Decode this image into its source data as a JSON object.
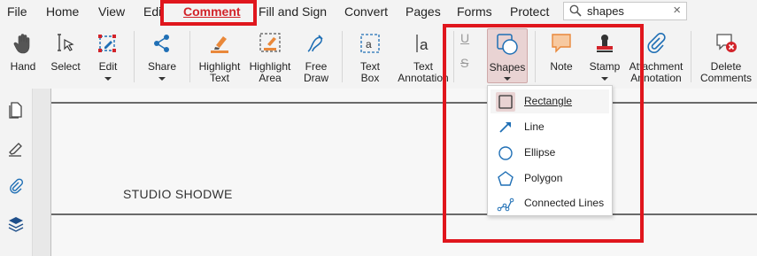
{
  "menu": {
    "items": [
      "File",
      "Home",
      "View",
      "Edi",
      "Comment",
      "Fill and Sign",
      "Convert",
      "Pages",
      "Forms",
      "Protect"
    ],
    "active": "Comment"
  },
  "search": {
    "value": "shapes"
  },
  "ribbon": {
    "hand": "Hand",
    "select": "Select",
    "edit": "Edit",
    "share": "Share",
    "highlight_text": "Highlight\nText",
    "highlight_area": "Highlight\nArea",
    "free_draw": "Free\nDraw",
    "text_box": "Text\nBox",
    "text_annotation": "Text\nAnnotation",
    "underline_glyph": "U",
    "strike_glyph": "S",
    "shapes": "Shapes",
    "note": "Note",
    "stamp": "Stamp",
    "attachment_annotation": "Attachment\nAnnotation",
    "delete_comments": "Delete\nComments"
  },
  "shapes_menu": {
    "items": [
      "Rectangle",
      "Line",
      "Ellipse",
      "Polygon",
      "Connected Lines"
    ],
    "selected": "Rectangle"
  },
  "document": {
    "text": "STUDIO SHODWE"
  },
  "colors": {
    "accent": "#d2232a",
    "icon_blue": "#1f6fb5",
    "annotation_red": "#e0161d",
    "note_orange": "#e9883a"
  }
}
